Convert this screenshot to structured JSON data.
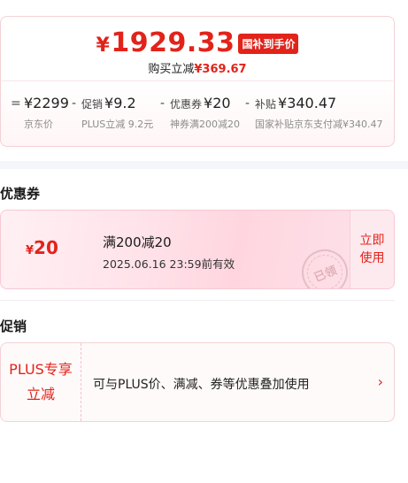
{
  "price": {
    "currency": "¥",
    "final": "1929.33",
    "final_tag": "国补到手价",
    "save_label": "购买立减",
    "save_amount": "¥369.67"
  },
  "formula": {
    "equals": "=",
    "minus": "-",
    "base_value": "¥2299",
    "base_label": "京东价",
    "promo_label": "促销",
    "promo_value": "¥9.2",
    "promo_desc": "PLUS立减 9.2元",
    "coupon_label": "优惠券",
    "coupon_value": "¥20",
    "coupon_desc": "神券满200减20",
    "subsidy_label": "补贴",
    "subsidy_value": "¥340.47",
    "subsidy_desc": "国家补贴京东支付减¥340.47"
  },
  "coupon_section": {
    "title": "优惠券",
    "currency": "¥",
    "amount": "20",
    "condition": "满200减20",
    "expiry": "2025.06.16 23:59前有效",
    "button": [
      "立即",
      "使用"
    ],
    "stamp": "已领"
  },
  "promo_section": {
    "title": "促销",
    "badge": [
      "PLUS专享",
      "立减"
    ],
    "text": "可与PLUS价、满减、券等优惠叠加使用",
    "chevron": "›"
  }
}
